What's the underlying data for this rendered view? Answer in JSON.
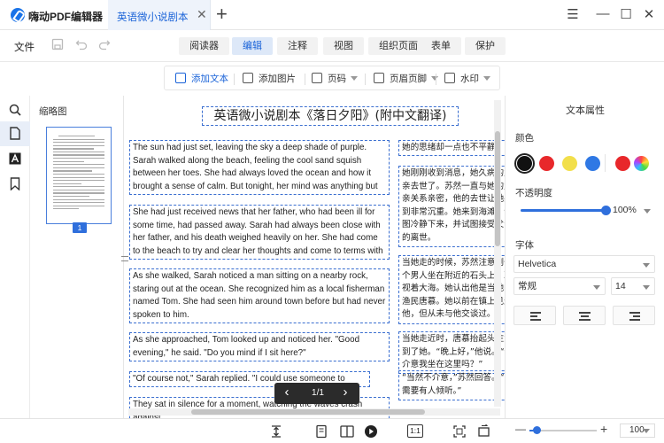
{
  "app": {
    "name": "嗨动PDF编辑器"
  },
  "tab": {
    "label": "英语微小说剧本《落日夕阳》（附中文翻译）.pdf",
    "close": "✕",
    "new": "+"
  },
  "window": {
    "menu": "☰",
    "minimize": "—",
    "maximize": "☐",
    "close": "✕"
  },
  "menubar": {
    "file": "文件",
    "tabs": [
      "阅读器",
      "编辑",
      "注释",
      "视图",
      "组织页面",
      "表单",
      "保护"
    ],
    "active_tab": "编辑"
  },
  "tools": {
    "add_text": "添加文本",
    "add_image": "添加图片",
    "page_number": "页码",
    "header_footer": "页眉页脚",
    "watermark": "水印"
  },
  "thumbnails": {
    "title": "缩略图",
    "page_number": "1"
  },
  "document": {
    "title": "英语微小说剧本《落日夕阳》(附中文翻译)",
    "english": [
      "The sun had just set, leaving the sky a deep shade of purple. Sarah walked along the beach, feeling the cool sand squish between her toes. She had always loved the ocean and how it brought a sense of calm. But tonight, her mind was anything but calm.",
      "She had just received news that her father, who had been ill for some time, had passed away. Sarah had always been close with her father, and his death weighed heavily on her. She had come to the beach to try and clear her thoughts and come to terms with his passing.",
      "As she walked, Sarah noticed a man sitting on a nearby rock, staring out at the ocean. She recognized him as a local fisherman named Tom. She had seen him around town before but had never spoken to him.",
      "As she approached, Tom looked up and noticed her. \"Good evening,\" he said. \"Do you mind if I sit here?\"",
      "\"Of course not,\" Sarah replied. \"I could use someone to listen.\"",
      "They sat in silence for a moment, watching the waves crash against"
    ],
    "chinese": [
      "她的思绪却一点也不平静。",
      "她刚刚收到消息，她久病的父亲去世了。苏然一直与她的父亲关系亲密，他的去世让她感到非常沉重。她来到海滩，试图冷静下来，并试图接受父亲的离世。",
      "当她走的时候，苏然注意到一个男人坐在附近的石头上，凝视着大海。她认出他是当地的渔民唐慕。她以前在镇上见过他，但从未与他交谈过。",
      "当她走近时，唐慕抬起头注意到了她。“晚上好，”他说。“你介意我坐在这里吗？”",
      "“当然不介意，”苏然回答。“我需要有人倾听。”"
    ],
    "pager": {
      "prev": "‹",
      "text": "1/1",
      "next": "›"
    }
  },
  "properties": {
    "title": "文本属性",
    "color_label": "颜色",
    "colors": [
      "#111111",
      "#e8282b",
      "#f2df4b",
      "#2f78e4",
      "#e8282b"
    ],
    "opacity_label": "不透明度",
    "opacity_value": "100%",
    "opacity": 1.0,
    "font_label": "字体",
    "font_family": "Helvetica",
    "font_style": "常规",
    "font_size": "14"
  },
  "statusbar": {
    "fit_label": "1:1",
    "zoom_minus": "—",
    "zoom_plus": "+",
    "zoom_value": "100"
  }
}
